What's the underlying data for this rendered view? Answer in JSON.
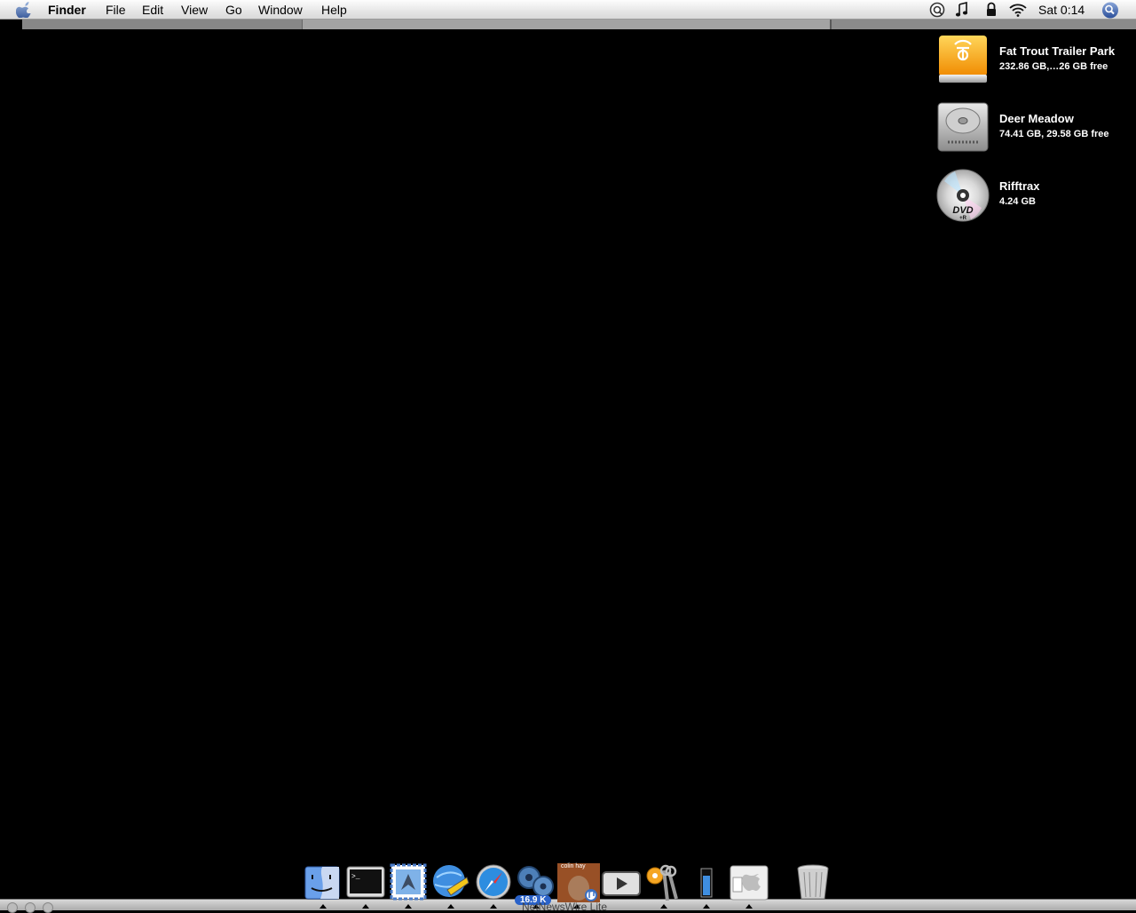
{
  "menubar": {
    "app_name": "Finder",
    "items": [
      "File",
      "Edit",
      "View",
      "Go",
      "Window",
      "Help"
    ],
    "clock": "Sat 0:14",
    "status_icons": [
      "quicksilver-icon",
      "itunes-music-icon",
      "lock-icon",
      "wifi-icon",
      "spotlight-icon"
    ]
  },
  "desktop": {
    "volumes": [
      {
        "name": "Fat Trout Trailer Park",
        "info": "232.86 GB,…26 GB free",
        "icon": "firewire-drive-icon"
      },
      {
        "name": "Deer Meadow",
        "info": "74.41 GB, 29.58 GB free",
        "icon": "hard-drive-icon"
      },
      {
        "name": "Rifftrax",
        "info": "4.24 GB",
        "icon": "dvd-disc-icon"
      }
    ]
  },
  "dock": {
    "items": [
      {
        "name": "finder-dock-icon",
        "running": true
      },
      {
        "name": "terminal-dock-icon",
        "running": true
      },
      {
        "name": "mail-dock-icon",
        "running": true
      },
      {
        "name": "network-utility-dock-icon",
        "running": true
      },
      {
        "name": "safari-dock-icon",
        "running": true
      },
      {
        "name": "newsfire-dock-icon",
        "running": true
      },
      {
        "name": "itunes-album-dock-icon",
        "running": true
      },
      {
        "name": "front-row-dock-icon",
        "running": false
      },
      {
        "name": "keychain-dock-icon",
        "running": true
      },
      {
        "name": "battery-dock-icon",
        "running": true
      },
      {
        "name": "system-prefs-dock-icon",
        "running": true
      },
      {
        "name": "trash-dock-icon",
        "running": false
      }
    ],
    "download_badge": "16.9 K",
    "hover_label": "NetNewsWire Lite",
    "album_text": "colin hay"
  }
}
